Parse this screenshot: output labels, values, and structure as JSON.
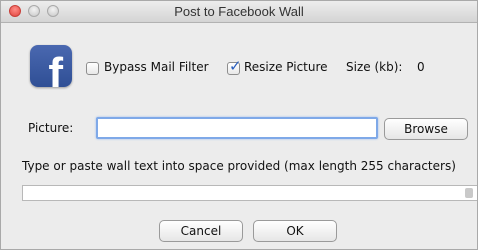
{
  "window": {
    "title": "Post to Facebook Wall"
  },
  "logo": {
    "glyph": "f",
    "color": "#3b5998"
  },
  "options": {
    "bypass_mail_filter": {
      "label": "Bypass Mail Filter",
      "checked": false
    },
    "resize_picture": {
      "label": "Resize Picture",
      "checked": true,
      "check_glyph": "✓"
    },
    "size_label": "Size (kb):",
    "size_value": "0"
  },
  "picture": {
    "label": "Picture:",
    "value": "",
    "browse_label": "Browse"
  },
  "wall": {
    "instruction": "Type or paste wall text into space provided (max length 255 characters)",
    "value": ""
  },
  "buttons": {
    "cancel_label": "Cancel",
    "ok_label": "OK"
  },
  "colors": {
    "accent": "#7fa9e8",
    "checkmark": "#2a5fbf",
    "close_button": "#e0443e"
  }
}
